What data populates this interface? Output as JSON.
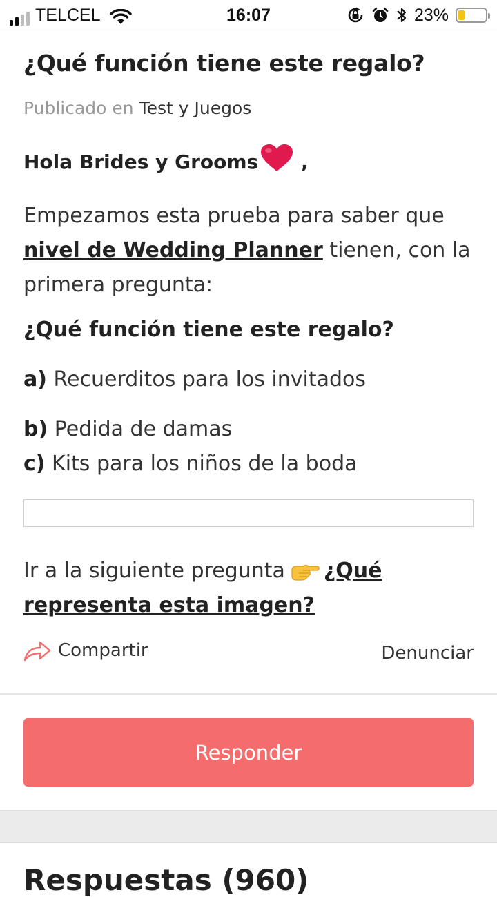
{
  "status_bar": {
    "carrier": "TELCEL",
    "time": "16:07",
    "battery_percent": "23%",
    "battery_level": 0.23,
    "icons": [
      "signal-icon",
      "wifi-icon",
      "orientation-lock-icon",
      "alarm-icon",
      "bluetooth-icon",
      "battery-icon"
    ]
  },
  "post": {
    "title": "¿Qué función tiene este regalo?",
    "published_prefix": "Publicado en",
    "category": "Test y Juegos",
    "greeting": "Hola Brides y Grooms",
    "greeting_suffix": " ,",
    "intro_before": "Empezamos esta prueba para saber que ",
    "intro_link": "nivel de Wedding Planner",
    "intro_after": " tienen, con la primera pregunta:",
    "question": "¿Qué función tiene este regalo?",
    "options": [
      {
        "letter": "a)",
        "text": " Recuerditos para los invitados"
      },
      {
        "letter": "b)",
        "text": " Pedida de damas"
      },
      {
        "letter": "c)",
        "text": " Kits para los niños de la boda"
      }
    ],
    "next_prefix": "Ir a la siguiente pregunta",
    "next_link": "¿Qué representa esta imagen?"
  },
  "actions": {
    "share_label": "Compartir",
    "report_label": "Denunciar"
  },
  "reply_button": "Responder",
  "responses_heading": "Respuestas (960)",
  "colors": {
    "accent": "#f56c6c",
    "heart": "#e0194f",
    "battery": "#f3c316"
  }
}
